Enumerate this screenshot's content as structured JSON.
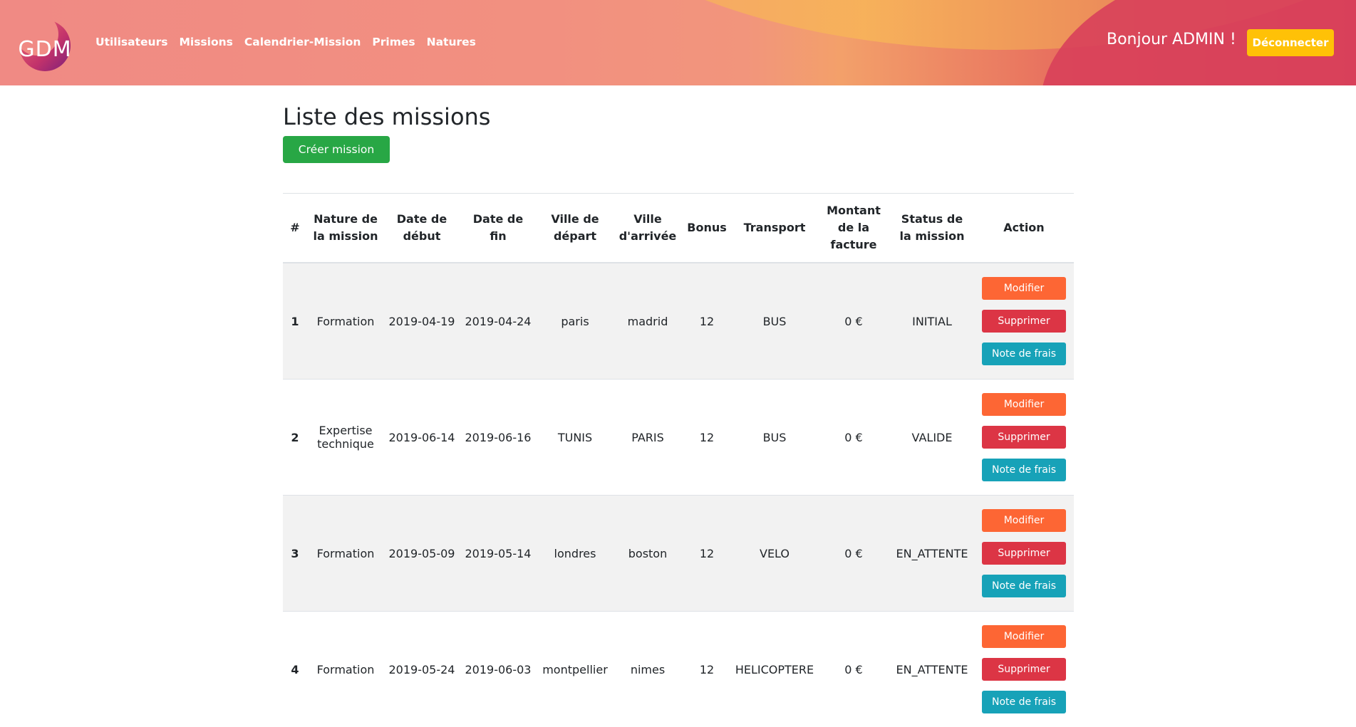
{
  "header": {
    "logo_text": "GDM",
    "nav": [
      {
        "label": "Utilisateurs"
      },
      {
        "label": "Missions"
      },
      {
        "label": "Calendrier-Mission"
      },
      {
        "label": "Primes"
      },
      {
        "label": "Natures"
      }
    ],
    "greeting": "Bonjour ADMIN !",
    "logout_label": "Déconnecter"
  },
  "main": {
    "title": "Liste des missions",
    "create_label": "Créer mission"
  },
  "table": {
    "columns": [
      "#",
      "Nature de la mission",
      "Date de début",
      "Date de fin",
      "Ville de départ",
      "Ville d'arrivée",
      "Bonus",
      "Transport",
      "Montant de la facture",
      "Status de la mission",
      "Action"
    ],
    "rows": [
      {
        "id": "1",
        "nature": "Formation",
        "start": "2019-04-19",
        "end": "2019-04-24",
        "from": "paris",
        "to": "madrid",
        "bonus": "12",
        "transport": "BUS",
        "amount": "0 €",
        "status": "INITIAL"
      },
      {
        "id": "2",
        "nature": "Expertise technique",
        "start": "2019-06-14",
        "end": "2019-06-16",
        "from": "TUNIS",
        "to": "PARIS",
        "bonus": "12",
        "transport": "BUS",
        "amount": "0 €",
        "status": "VALIDE"
      },
      {
        "id": "3",
        "nature": "Formation",
        "start": "2019-05-09",
        "end": "2019-05-14",
        "from": "londres",
        "to": "boston",
        "bonus": "12",
        "transport": "VELO",
        "amount": "0 €",
        "status": "EN_ATTENTE"
      },
      {
        "id": "4",
        "nature": "Formation",
        "start": "2019-05-24",
        "end": "2019-06-03",
        "from": "montpellier",
        "to": "nimes",
        "bonus": "12",
        "transport": "HELICOPTERE",
        "amount": "0 €",
        "status": "EN_ATTENTE"
      }
    ],
    "actions": {
      "edit_label": "Modifier",
      "delete_label": "Supprimer",
      "expense_label": "Note de frais"
    }
  },
  "colors": {
    "modifier": "#fd6634",
    "supprimer": "#dc3545",
    "note": "#17a2b8",
    "create": "#28a745",
    "logout": "#ffc107"
  }
}
